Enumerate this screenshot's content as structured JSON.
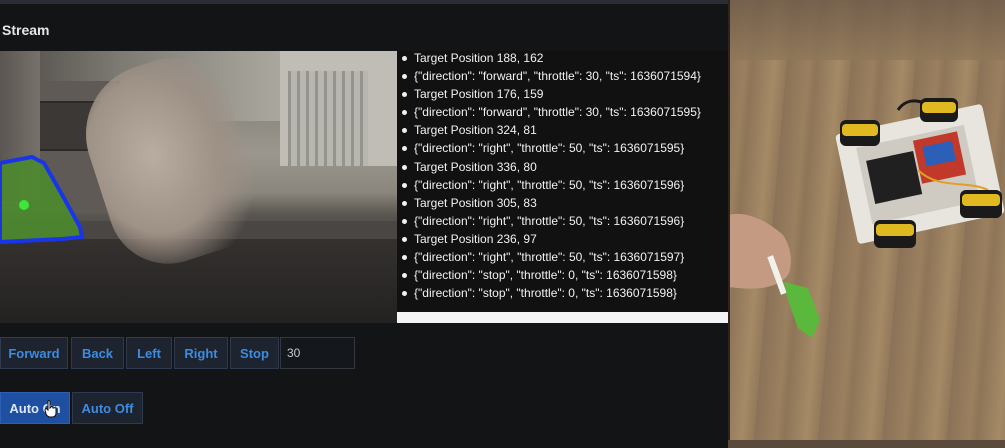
{
  "panel": {
    "title": "Stream"
  },
  "log": {
    "items": [
      "Target Position 188, 162",
      "{\"direction\": \"forward\", \"throttle\": 30, \"ts\": 1636071594}",
      "Target Position 176, 159",
      "{\"direction\": \"forward\", \"throttle\": 30, \"ts\": 1636071595}",
      "Target Position 324, 81",
      "{\"direction\": \"right\", \"throttle\": 50, \"ts\": 1636071595}",
      "Target Position 336, 80",
      "{\"direction\": \"right\", \"throttle\": 50, \"ts\": 1636071596}",
      "Target Position 305, 83",
      "{\"direction\": \"right\", \"throttle\": 50, \"ts\": 1636071596}",
      "Target Position 236, 97",
      "{\"direction\": \"right\", \"throttle\": 50, \"ts\": 1636071597}",
      "{\"direction\": \"stop\", \"throttle\": 0, \"ts\": 1636071598}",
      "{\"direction\": \"stop\", \"throttle\": 0, \"ts\": 1636071598}"
    ]
  },
  "controls": {
    "forward": "Forward",
    "back": "Back",
    "left": "Left",
    "right": "Right",
    "stop": "Stop",
    "throttle_value": "30",
    "auto_on": "Auto On",
    "auto_off": "Auto Off"
  },
  "colors": {
    "accent": "#3c8ce0",
    "active": "#1f4fa0",
    "target_outline": "#1a35e8",
    "target_fill": "#4c8a2e",
    "target_dot": "#39e83a"
  },
  "icons": {
    "cursor": "hand-pointer-icon"
  }
}
